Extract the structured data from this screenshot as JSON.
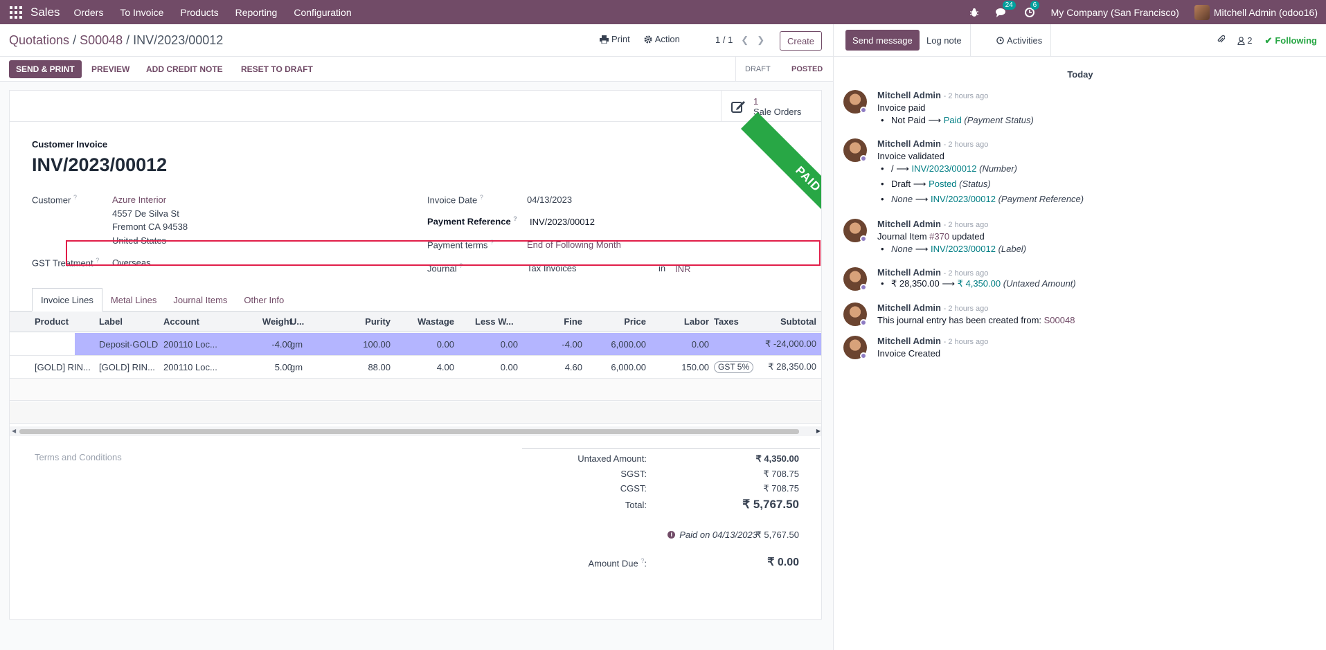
{
  "navbar": {
    "app": "Sales",
    "menu": [
      "Orders",
      "To Invoice",
      "Products",
      "Reporting",
      "Configuration"
    ],
    "messages_count": "24",
    "activities_count": "6",
    "company": "My Company (San Francisco)",
    "user": "Mitchell Admin (odoo16)"
  },
  "breadcrumb": {
    "part1": "Quotations",
    "sep1": " / ",
    "part2": "S00048",
    "sep2": " / ",
    "current": "INV/2023/00012"
  },
  "controls": {
    "print": "Print",
    "action": "Action",
    "pager": "1 / 1",
    "create": "Create"
  },
  "statusbar": {
    "buttons": [
      "SEND & PRINT",
      "PREVIEW",
      "ADD CREDIT NOTE",
      "RESET TO DRAFT"
    ],
    "stages": [
      "DRAFT",
      "POSTED"
    ]
  },
  "smart_button": {
    "count": "1",
    "label": "Sale Orders"
  },
  "ribbon": "PAID",
  "form": {
    "type": "Customer Invoice",
    "name": "INV/2023/00012",
    "customer_label": "Customer",
    "customer_name": "Azure Interior",
    "address1": "4557 De Silva St",
    "address2": "Fremont CA 94538",
    "address3": "United States",
    "gst_label": "GST Treatment",
    "gst_value": "Overseas",
    "invoice_date_label": "Invoice Date",
    "invoice_date": "04/13/2023",
    "payment_ref_label": "Payment Reference",
    "payment_ref": "INV/2023/00012",
    "payment_terms_label": "Payment terms",
    "payment_terms": "End of Following Month",
    "journal_label": "Journal",
    "journal": "Tax Invoices",
    "in": "in",
    "currency": "INR",
    "help_mark": "?"
  },
  "tabs": [
    "Invoice Lines",
    "Metal Lines",
    "Journal Items",
    "Other Info"
  ],
  "table": {
    "headers": [
      "Product",
      "Label",
      "Account",
      "Weight",
      "U...",
      "Purity",
      "Wastage",
      "Less W...",
      "Fine",
      "Price",
      "Labor",
      "Taxes",
      "Subtotal"
    ],
    "rows": [
      {
        "product": "",
        "label": "Deposit-GOLD",
        "account": "200110 Loc...",
        "weight": "-4.00",
        "uom": "gm",
        "purity": "100.00",
        "wastage": "0.00",
        "less": "0.00",
        "fine": "-4.00",
        "price": "6,000.00",
        "labor": "0.00",
        "taxes": "",
        "subtotal": "₹ -24,000.00"
      },
      {
        "product": "[GOLD] RIN...",
        "label": "[GOLD] RIN...",
        "account": "200110 Loc...",
        "weight": "5.00",
        "uom": "gm",
        "purity": "88.00",
        "wastage": "4.00",
        "less": "0.00",
        "fine": "4.60",
        "price": "6,000.00",
        "labor": "150.00",
        "taxes": "GST 5%",
        "subtotal": "₹ 28,350.00"
      }
    ]
  },
  "terms_placeholder": "Terms and Conditions",
  "totals": {
    "untaxed_label": "Untaxed Amount:",
    "untaxed": "₹ 4,350.00",
    "sgst_label": "SGST:",
    "sgst": "₹ 708.75",
    "cgst_label": "CGST:",
    "cgst": "₹ 708.75",
    "total_label": "Total:",
    "total": "₹ 5,767.50",
    "paid_label": "Paid on 04/13/2023",
    "paid": "₹ 5,767.50",
    "due_label": "Amount Due",
    "due": "₹ 0.00"
  },
  "chatter": {
    "send_message": "Send message",
    "log_note": "Log note",
    "activities": "Activities",
    "followers": "2",
    "following": "Following",
    "day": "Today",
    "author": "Mitchell Admin",
    "time": "- 2 hours ago",
    "arrow": "⟶",
    "m1_body": "Invoice paid",
    "m1_old": "Not Paid",
    "m1_new": "Paid",
    "m1_field": "(Payment Status)",
    "m2_body": "Invoice validated",
    "m2_l1_old": "/",
    "m2_l1_new": "INV/2023/00012",
    "m2_l1_field": "(Number)",
    "m2_l2_old": "Draft",
    "m2_l2_new": "Posted",
    "m2_l2_field": "(Status)",
    "m2_l3_old": "None",
    "m2_l3_new": "INV/2023/00012",
    "m2_l3_field": "(Payment Reference)",
    "m3_pre": "Journal Item ",
    "m3_link": "#370",
    "m3_post": " updated",
    "m3_old": "None",
    "m3_new": "INV/2023/00012",
    "m3_field": "(Label)",
    "m4_old": "₹ 28,350.00",
    "m4_new": "₹ 4,350.00",
    "m4_field": "(Untaxed Amount)",
    "m5_pre": "This journal entry has been created from: ",
    "m5_link": "S00048",
    "m6_body": "Invoice Created"
  }
}
